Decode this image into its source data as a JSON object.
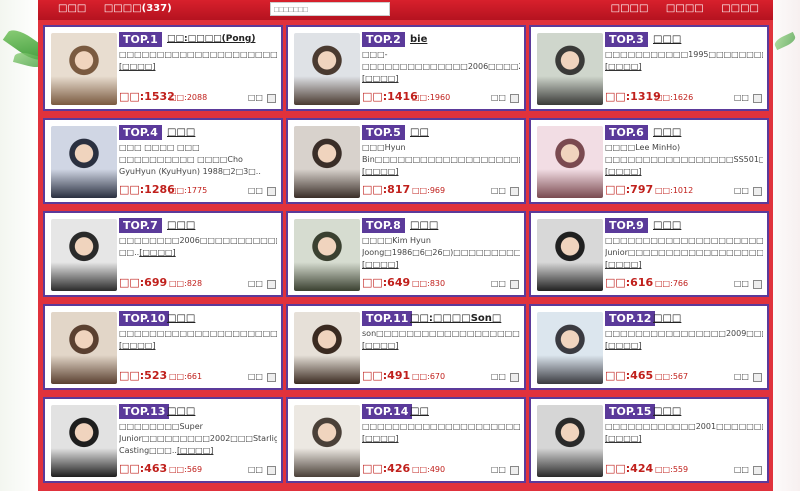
{
  "header": {
    "nav_left": [
      "□□□",
      "□□□□(337)"
    ],
    "search_placeholder": "□□□□□□□",
    "nav_right": [
      "□□□□",
      "□□□□",
      "□□□□"
    ]
  },
  "vote_label": "□□",
  "cards": [
    {
      "rank": "TOP.1",
      "name": "□□:□□□□(Pong)",
      "desc": "□□□□□□□□□□□□□□□□□□□□□□□□□□□□□□□□□□□□□□□□□□□□□□□□□□□□□□□□□□□□..",
      "more": "[□□□□]",
      "votes": "□□:1532",
      "views": "□□:2088"
    },
    {
      "rank": "TOP.2",
      "name": "bie",
      "desc": "□□□-□□□□□□□□□□□□□□2006□□□□21□□□□□□□□□□□□□□□□□□□□□□□□□□□□□□□□□..",
      "more": "[□□□□]",
      "votes": "□□:1416",
      "views": "□□:1960"
    },
    {
      "rank": "TOP.3",
      "name": "□□□",
      "desc": "□□□□□□□□□□□1995□□□□□□□□□□□2000□□□□□□□□□□□□□□□□□□□□□□□□□□□□□□□..",
      "more": "[□□□□]",
      "votes": "□□:1319",
      "views": "□□:1626"
    },
    {
      "rank": "TOP.4",
      "name": "□□□",
      "desc": "□□□ □□□□ □□□ □□□□□□□□□□ □□□□Cho GyuHyun (KyuHyun) 1988□2□3□..",
      "more": "[□□□□]",
      "votes": "□□:1286",
      "views": "□□:1775"
    },
    {
      "rank": "TOP.5",
      "name": "□□",
      "desc": "□□□Hyun Bin□□□□□□□□□□□□□□□□□□□□□□□□□□□□□□□□□□□□□□□□□□□□□□..",
      "more": "[□□□□]",
      "votes": "□□:817",
      "views": "□□:969"
    },
    {
      "rank": "TOP.6",
      "name": "□□□",
      "desc": "□□□□Lee MinHo) □□□□□□□□□□□□□□□□□SS501□□□□□□□□□□□□□□□□□□□□□□□..",
      "more": "[□□□□]",
      "votes": "□□:797",
      "views": "□□:1012"
    },
    {
      "rank": "TOP.7",
      "name": "□□□",
      "desc": "□□□□□□□□2006□□□□□□□□□□□□□□□□□□□□□□□2009□□□□□□□□□□□□□□□ □□..",
      "more": "[□□□□]",
      "votes": "□□:699",
      "views": "□□:828"
    },
    {
      "rank": "TOP.8",
      "name": "□□□",
      "desc": "□□□□Kim Hyun Joong□1986□6□26□)□□□□□□□□□□□□□□□□□□SS501□□□□2005□□□..",
      "more": "[□□□□]",
      "votes": "□□:649",
      "views": "□□:830"
    },
    {
      "rank": "TOP.9",
      "name": "□□□",
      "desc": "□□□□□□□□□□□□□□□□□□□□□□□□□□□Super Junior□□□□□□□□□□□□□□□□□□□□..",
      "more": "[□□□□]",
      "votes": "□□:616",
      "views": "□□:766"
    },
    {
      "rank": "TOP.10",
      "name": "□□□",
      "desc": "□□□□□□□□□□□□□□□□□□□□□□□□□□□□□□□□\"□□\"□□FANS□□□□□□□□□□□..",
      "more": "[□□□□]",
      "votes": "□□:523",
      "views": "□□:661"
    },
    {
      "rank": "TOP.11",
      "name": "□□:□□□□Son□",
      "desc": "son□□□□□□□□□□□□□□□□□□□□□□□□□□□□□□□□□□□□□□□□□□□□□□□□□□□□□..",
      "more": "[□□□□]",
      "votes": "□□:491",
      "views": "□□:670"
    },
    {
      "rank": "TOP.12",
      "name": "□□□",
      "desc": "□□□□□□□□□□□□□□□□2009□□□□□□□□□□□□□□□□□□□□□□□□□□□□□□□□..",
      "more": "[□□□□]",
      "votes": "□□:465",
      "views": "□□:567"
    },
    {
      "rank": "TOP.13",
      "name": "□□□",
      "desc": "□□□□□□□□Super Junior□□□□□□□□□2002□□□Starlight Casting□□□..",
      "more": "[□□□□]",
      "votes": "□□:463",
      "views": "□□:569"
    },
    {
      "rank": "TOP.14",
      "name": "□□",
      "desc": "□□□□□□□□□□□□□□□□□□□□□□□□□□□□□□□□□□□□□□□□□□..",
      "more": "[□□□□]",
      "votes": "□□:426",
      "views": "□□:490"
    },
    {
      "rank": "TOP.15",
      "name": "□□□",
      "desc": "□□□□□□□□□□□□2001□□□□□□□□□□□□□□□□□□□□□□□□□□□□□□□□□□..",
      "more": "[□□□□]",
      "votes": "□□:424",
      "views": "□□:559"
    }
  ]
}
